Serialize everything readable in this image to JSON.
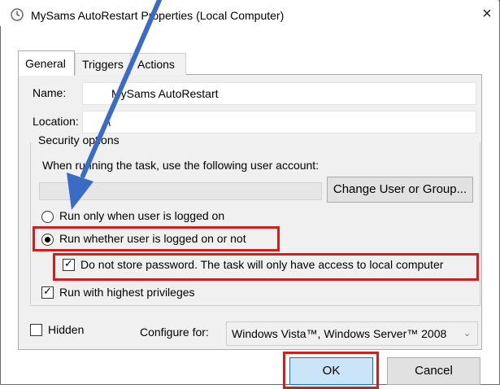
{
  "window": {
    "title": "MySams AutoRestart Properties (Local Computer)",
    "close_glyph": "×",
    "app_icon": "clock-icon"
  },
  "tabs": [
    {
      "label": "General",
      "selected": true
    },
    {
      "label": "Triggers",
      "selected": false
    },
    {
      "label": "Actions",
      "selected": false
    }
  ],
  "general": {
    "name_label": "Name:",
    "name_value": "MySams AutoRestart",
    "location_label": "Location:",
    "location_value": "\\",
    "security_group_label": "Security options",
    "account_prompt": "When running the task, use the following user account:",
    "user_account_value": "",
    "change_user_button": "Change User or Group...",
    "radio_logged_on": "Run only when user is logged on",
    "radio_whether": "Run whether user is logged on or not",
    "radio_selected": "whether",
    "checkbox_no_password": "Do not store password.  The task will only have access to local computer",
    "checkbox_no_password_checked": true,
    "checkbox_highest": "Run with highest privileges",
    "checkbox_highest_checked": true,
    "checkbox_hidden": "Hidden",
    "checkbox_hidden_checked": false,
    "configure_label": "Configure for:",
    "configure_value": "Windows Vista™, Windows Server™ 2008"
  },
  "buttons": {
    "ok": "OK",
    "cancel": "Cancel"
  },
  "annotations": {
    "highlight_color": "#d0201d",
    "arrow_color": "#3b6cc5"
  }
}
